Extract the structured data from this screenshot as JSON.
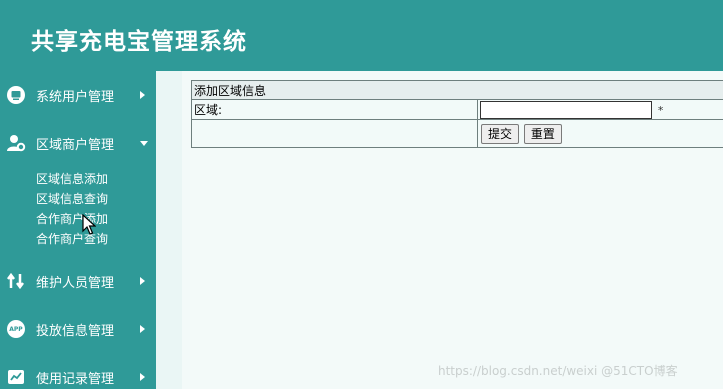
{
  "header": {
    "title": "共享充电宝管理系统"
  },
  "sidebar": {
    "items": [
      {
        "label": "系统用户管理",
        "icon": "monitor-icon",
        "expanded": false
      },
      {
        "label": "区域商户管理",
        "icon": "user-gear-icon",
        "expanded": true
      },
      {
        "label": "维护人员管理",
        "icon": "wrench-arrows-icon",
        "expanded": false
      },
      {
        "label": "投放信息管理",
        "icon": "app-badge-icon",
        "expanded": false
      },
      {
        "label": "使用记录管理",
        "icon": "chart-icon",
        "expanded": false
      }
    ],
    "submenu": [
      "区域信息添加",
      "区域信息查询",
      "合作商户添加",
      "合作商户查询"
    ],
    "icon_app_text": "APP"
  },
  "form": {
    "title": "添加区域信息",
    "field_label": "区域:",
    "field_value": "",
    "required_mark": "*",
    "submit_label": "提交",
    "reset_label": "重置"
  },
  "watermark": "https://blog.csdn.net/weixi @51CTO博客",
  "colors": {
    "theme": "#2f9a98",
    "content_bg": "#f3faf9"
  }
}
